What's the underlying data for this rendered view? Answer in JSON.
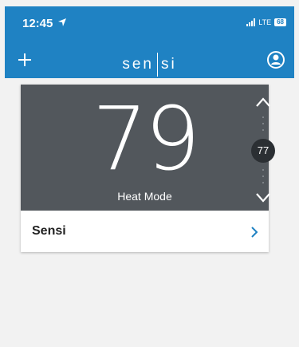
{
  "status": {
    "time": "12:45",
    "network": "LTE",
    "battery": "68"
  },
  "header": {
    "logo_left": "sen",
    "logo_right": "si"
  },
  "thermostat": {
    "current_temp": "79",
    "mode": "Heat Mode",
    "setpoint": "77"
  },
  "device": {
    "name": "Sensi"
  },
  "colors": {
    "header_blue": "#1f82c3",
    "display_gray": "#52575c",
    "chevron_blue": "#1f82c3"
  }
}
